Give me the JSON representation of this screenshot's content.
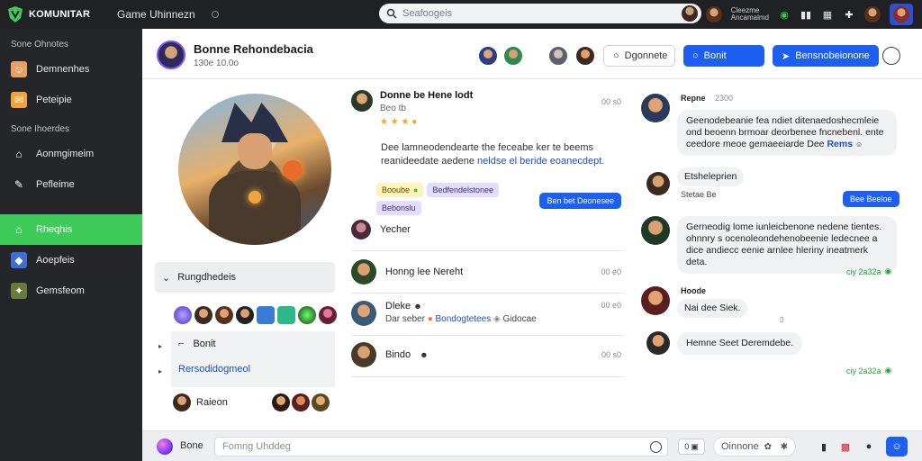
{
  "app": {
    "brand": "KOMUNITAR",
    "game_title": "Game Uhinnezn"
  },
  "search": {
    "placeholder": "Seafoogeis"
  },
  "top_user": {
    "line1": "Cleezme",
    "line2": "Ancamalmd"
  },
  "sidebar": {
    "section1": "Sone Ohnotes",
    "section2": "Sone Ihoerdes",
    "items": [
      {
        "label": "Demnenhes",
        "icon": "user-face-icon"
      },
      {
        "label": "Peteipie",
        "icon": "envelope-icon"
      },
      {
        "label": "Aonmgimeim",
        "icon": "home-icon"
      },
      {
        "label": "Pefleime",
        "icon": "wrench-icon"
      },
      {
        "label": "Rheqhis",
        "icon": "home-icon",
        "active": true
      },
      {
        "label": "Aoepfeis",
        "icon": "shield-icon"
      },
      {
        "label": "Gemsfeom",
        "icon": "map-icon"
      }
    ]
  },
  "header": {
    "name": "Bonne Rehondebacia",
    "sub": "130e 10.0o",
    "btn_outline": "Dgonnete",
    "btn_blue": "Bonit",
    "btn_blue2": "Bensnobeionone"
  },
  "left_panel": {
    "group_label": "Rungdhedeis",
    "list": [
      "Bonit",
      "Rersodidogmeol"
    ],
    "bottom_label": "Raieon"
  },
  "feed": {
    "post": {
      "name": "Donne be Hene lodt",
      "meta": "Beo tb",
      "time": "00 s0",
      "body": "Dee lamneodendearte the feceabe ker te beems reanideedate aedene",
      "link": "neldse el beride eoanecdept.",
      "tag1": "Booube",
      "tag2": "Bedfendelstonee",
      "tag3": "Bebonslu",
      "blue_tag": "Ben bet Deonesee"
    },
    "rows": [
      {
        "label": "Yecher",
        "time": ""
      },
      {
        "label": "Honng lee Nereht",
        "time": "00 e0"
      },
      {
        "label": "Dleke",
        "sub": "Dar seber",
        "link": "Bondogtetees",
        "sub2": "Gidocae",
        "time": "00 e0"
      },
      {
        "label": "Bindo",
        "time": "00 s0"
      }
    ]
  },
  "chat": {
    "m1_name": "Repne",
    "m1_time": "2300",
    "m1_text": "Geenodebeanie fea ndiet ditenaedoshecmleie ond beoenn brmoar deorbenee fncnebenl. ente ceedore meoe gemaeeiarde Dee",
    "m1_link": "Rems",
    "m2_text": "Etsheleprien",
    "m2_label": "Stetae Be",
    "m2_pill": "Bee Beeloe",
    "m3_text": "Gerneodig lome iunleicbenone nedene tientes. ohnnry s ocenoleondehenobeenie ledecnee a dice andiecc eenie arnlee hleriny ineatmerk deta.",
    "m3_status": "ciy 2a32a",
    "m4_name": "Hoode",
    "m4_text": "Nai dee Siek.",
    "m5_text": "Hemne Seet Deremdebe.",
    "m5_status": "ciy 2a32a"
  },
  "bottom": {
    "label": "Bone",
    "input_placeholder": "Fomng Uhddeg",
    "count": "0",
    "select": "Oinnone"
  }
}
